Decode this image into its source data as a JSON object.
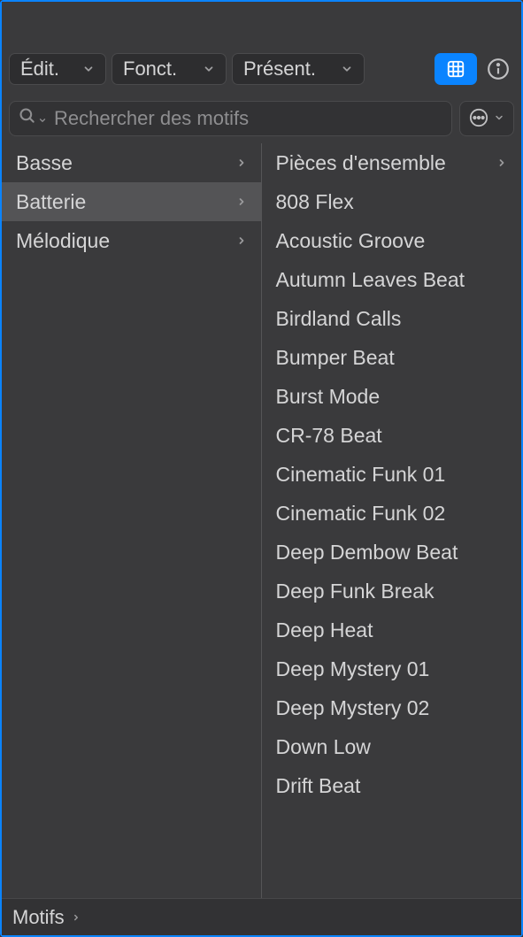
{
  "toolbar": {
    "edit_label": "Édit.",
    "func_label": "Fonct.",
    "present_label": "Présent."
  },
  "search": {
    "placeholder": "Rechercher des motifs"
  },
  "categories": [
    {
      "label": "Basse",
      "has_children": true,
      "selected": false
    },
    {
      "label": "Batterie",
      "has_children": true,
      "selected": true
    },
    {
      "label": "Mélodique",
      "has_children": true,
      "selected": false
    }
  ],
  "items": [
    {
      "label": "Pièces d'ensemble",
      "has_children": true
    },
    {
      "label": "808 Flex",
      "has_children": false
    },
    {
      "label": "Acoustic Groove",
      "has_children": false
    },
    {
      "label": "Autumn Leaves Beat",
      "has_children": false
    },
    {
      "label": "Birdland Calls",
      "has_children": false
    },
    {
      "label": "Bumper Beat",
      "has_children": false
    },
    {
      "label": "Burst Mode",
      "has_children": false
    },
    {
      "label": "CR-78 Beat",
      "has_children": false
    },
    {
      "label": "Cinematic Funk 01",
      "has_children": false
    },
    {
      "label": "Cinematic Funk 02",
      "has_children": false
    },
    {
      "label": "Deep Dembow Beat",
      "has_children": false
    },
    {
      "label": "Deep Funk Break",
      "has_children": false
    },
    {
      "label": "Deep Heat",
      "has_children": false
    },
    {
      "label": "Deep Mystery 01",
      "has_children": false
    },
    {
      "label": "Deep Mystery 02",
      "has_children": false
    },
    {
      "label": "Down Low",
      "has_children": false
    },
    {
      "label": "Drift Beat",
      "has_children": false
    }
  ],
  "breadcrumb": {
    "root": "Motifs"
  }
}
